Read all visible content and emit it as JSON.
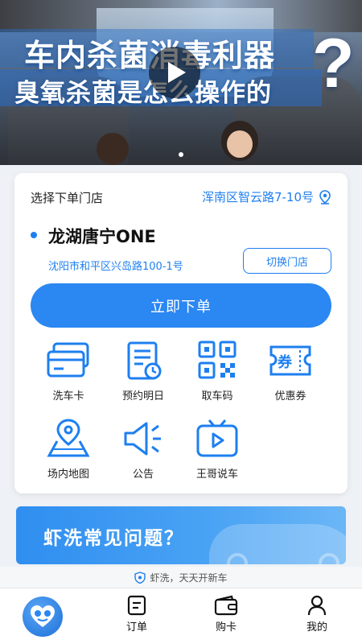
{
  "hero": {
    "title_line1": "车内杀菌消毒利器",
    "title_line2": "臭氧杀菌是怎么操作的",
    "qmark": "?",
    "play_icon": "play-icon"
  },
  "store_section": {
    "heading": "选择下单门店",
    "location": "浑南区智云路7-10号",
    "store_name": "龙湖唐宁ONE",
    "store_address": "沈阳市和平区兴岛路100-1号",
    "switch_label": "切换门店",
    "order_label": "立即下单"
  },
  "features": [
    {
      "label": "洗车卡",
      "icon": "card-icon"
    },
    {
      "label": "预约明日",
      "icon": "calendar-icon"
    },
    {
      "label": "取车码",
      "icon": "qrcode-icon"
    },
    {
      "label": "优惠券",
      "icon": "coupon-icon"
    },
    {
      "label": "场内地图",
      "icon": "map-icon"
    },
    {
      "label": "公告",
      "icon": "megaphone-icon"
    },
    {
      "label": "王哥说车",
      "icon": "tv-icon"
    }
  ],
  "coupon_glyph": "券",
  "faq": {
    "title": "虾洗常见问题？"
  },
  "slogan": "虾洗，天天开新车",
  "nav": {
    "items": [
      {
        "label": "订单",
        "icon": "order-icon"
      },
      {
        "label": "购卡",
        "icon": "wallet-icon"
      },
      {
        "label": "我的",
        "icon": "user-icon"
      }
    ]
  },
  "colors": {
    "accent": "#1e7ff0",
    "button": "#2b87f2"
  }
}
